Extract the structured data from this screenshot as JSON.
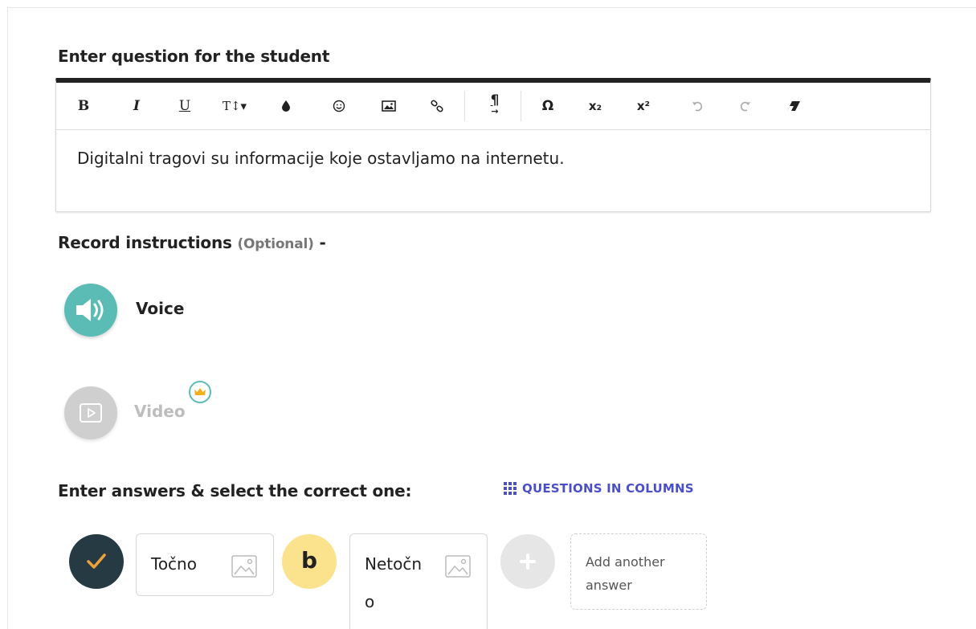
{
  "question_section": {
    "title": "Enter question for the student",
    "toolbar": {
      "bold": "B",
      "italic": "I",
      "underline": "U",
      "font_size": "T↕▾",
      "color_icon": "drop-icon",
      "emoji_icon": "emoji-icon",
      "image_icon": "image-icon",
      "link_icon": "link-icon",
      "paragraph": "¶",
      "omega": "Ω",
      "subscript": "x₂",
      "superscript": "x²",
      "undo_icon": "undo-icon",
      "redo_icon": "redo-icon",
      "eraser_icon": "eraser-icon"
    },
    "content": "Digitalni tragovi su informacije koje ostavljamo na internetu."
  },
  "instructions_section": {
    "title": "Record instructions",
    "optional": "(Optional)",
    "dash": "-",
    "voice_label": "Voice",
    "video_label": "Video"
  },
  "answers_section": {
    "title": "Enter answers & select the correct one:",
    "columns_link": "QUESTIONS IN COLUMNS",
    "answers": [
      {
        "marker": "✓",
        "marker_color": "#263a44",
        "text": "Točno"
      },
      {
        "marker": "b",
        "marker_color": "#fbe38e",
        "text_line1": "Netočn",
        "text_line2": "o"
      }
    ],
    "add_another": "Add another answer"
  },
  "colors": {
    "accent": "#5bbcb6",
    "link": "#4a4fc8",
    "check": "#f0a23a",
    "crown": "#f2b01e"
  }
}
